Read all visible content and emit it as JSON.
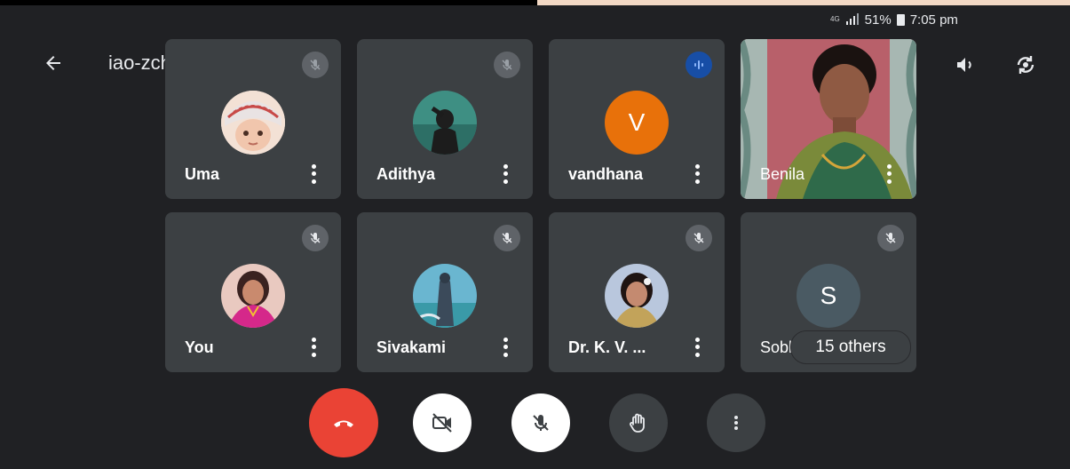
{
  "status_bar": {
    "network": "4G",
    "battery": "51%",
    "time": "7:05 pm"
  },
  "meeting": {
    "code": "iao-zchq-iqj",
    "caret": "▸"
  },
  "participants": [
    {
      "name": "Uma",
      "mic": "muted"
    },
    {
      "name": "Adithya",
      "mic": "muted"
    },
    {
      "name": "vandhana",
      "initial": "V",
      "mic": "speaking",
      "avatar_color": "#e8710a"
    },
    {
      "name": "Benila",
      "mic": "video"
    },
    {
      "name": "You",
      "mic": "muted"
    },
    {
      "name": "Sivakami",
      "mic": "muted"
    },
    {
      "name": "Dr. K. V. ...",
      "mic": "muted"
    },
    {
      "name": "Sobh",
      "initial": "S",
      "mic": "muted",
      "avatar_color": "#4a5a63"
    }
  ],
  "others_label": "15 others",
  "controls": [
    "end-call",
    "camera-off",
    "mic-off",
    "raise-hand",
    "more-options"
  ],
  "colors": {
    "background": "#202124",
    "tile": "#3c4043",
    "end_call": "#ea4335",
    "accent_blue": "#1a73e8"
  }
}
